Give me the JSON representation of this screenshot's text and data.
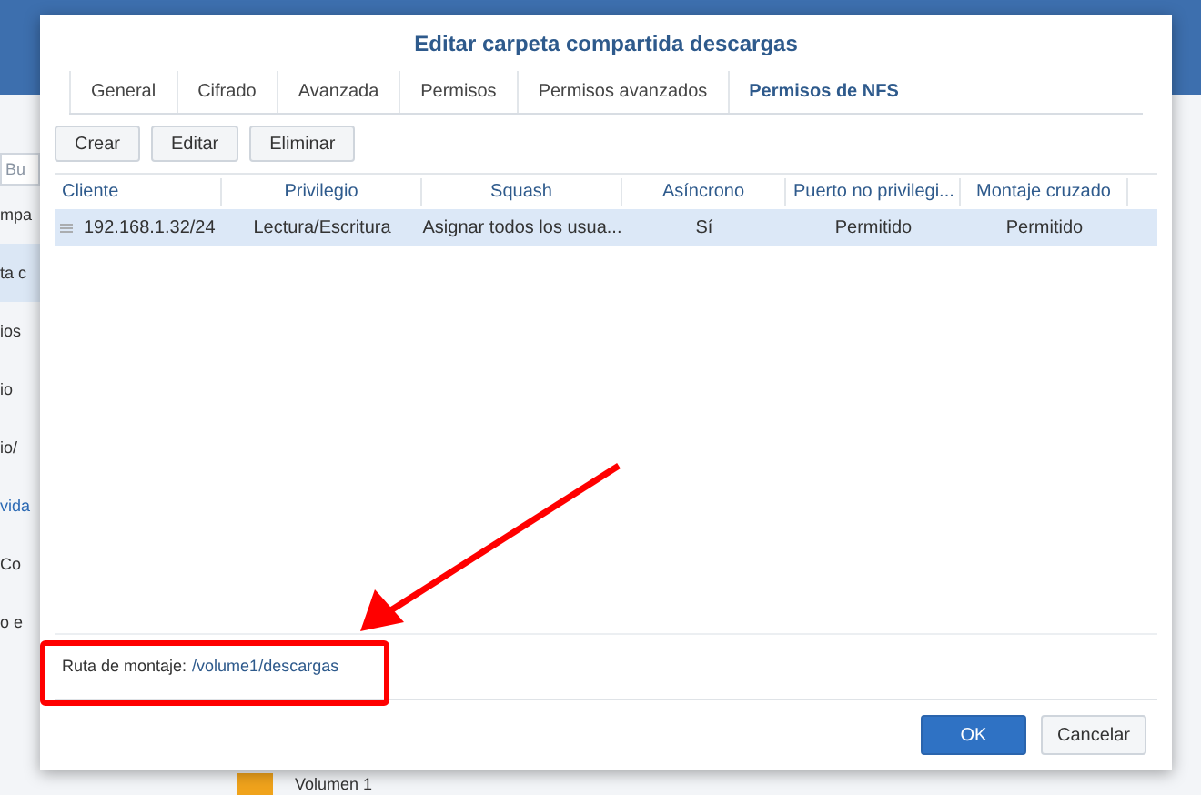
{
  "background": {
    "search_placeholder": "Bu",
    "items": [
      {
        "label": "mpa",
        "kind": "text",
        "selected": false
      },
      {
        "label": "ta c",
        "kind": "text",
        "selected": true
      },
      {
        "label": "ios",
        "kind": "text",
        "selected": false
      },
      {
        "label": "io",
        "kind": "text",
        "selected": false
      },
      {
        "label": "io/",
        "kind": "text",
        "selected": false
      },
      {
        "label": "vida",
        "kind": "link",
        "selected": false
      },
      {
        "label": "Co",
        "kind": "text",
        "selected": false
      },
      {
        "label": "o e",
        "kind": "text",
        "selected": false
      }
    ],
    "volume_label": "Volumen 1"
  },
  "dialog": {
    "title": "Editar carpeta compartida descargas",
    "tabs": [
      {
        "label": "General",
        "selected": false
      },
      {
        "label": "Cifrado",
        "selected": false
      },
      {
        "label": "Avanzada",
        "selected": false
      },
      {
        "label": "Permisos",
        "selected": false
      },
      {
        "label": "Permisos avanzados",
        "selected": false
      },
      {
        "label": "Permisos de NFS",
        "selected": true
      }
    ],
    "toolbar": [
      "Crear",
      "Editar",
      "Eliminar"
    ],
    "table": {
      "columns": [
        "Cliente",
        "Privilegio",
        "Squash",
        "Asíncrono",
        "Puerto no privilegi...",
        "Montaje cruzado"
      ],
      "rows": [
        {
          "selected": true,
          "cells": [
            "192.168.1.32/24",
            "Lectura/Escritura",
            "Asignar todos los usua...",
            "Sí",
            "Permitido",
            "Permitido"
          ]
        }
      ]
    },
    "mount_path": {
      "label": "Ruta de montaje:",
      "value": "/volume1/descargas"
    },
    "buttons": [
      {
        "label": "OK",
        "kind": "primary"
      },
      {
        "label": "Cancelar",
        "kind": "secondary"
      }
    ]
  }
}
